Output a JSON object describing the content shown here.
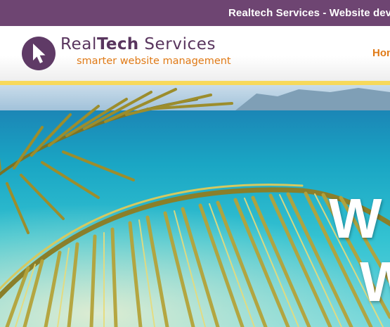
{
  "topbar": {
    "text": "Realtech Services - Website development and management"
  },
  "header": {
    "logo": {
      "name_regular": "Real",
      "name_bold": "Tech",
      "name_suffix": " Services",
      "tagline": "smarter website management",
      "icon": "cursor-arrow-circle-icon"
    },
    "nav": {
      "items": [
        {
          "label": "Home"
        }
      ]
    }
  },
  "hero": {
    "headline_line1": "W",
    "headline_line2": "W"
  },
  "colors": {
    "topbar_bg": "#6e4572",
    "brand_purple": "#59355e",
    "accent_orange": "#e07a16",
    "rule_yellow": "#f7d95a",
    "sea": "#1fb0c6",
    "palm": "#c8b13a"
  }
}
